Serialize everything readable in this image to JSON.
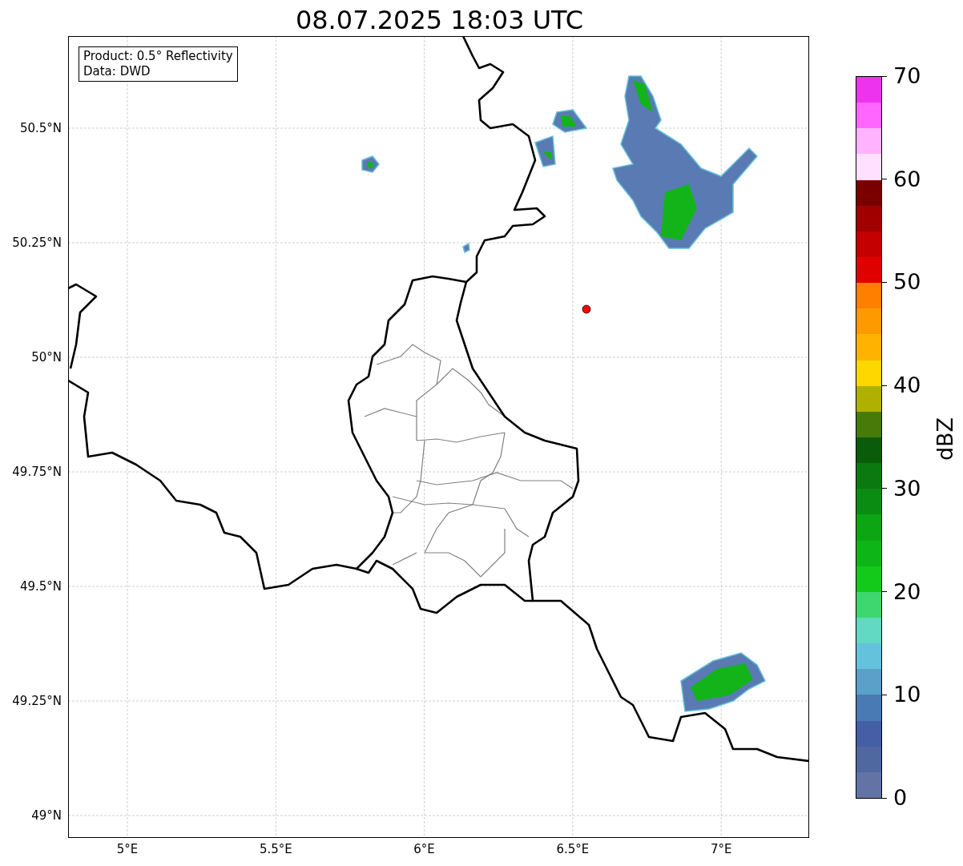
{
  "title": "08.07.2025 18:03 UTC",
  "legend": [
    "Product: 0.5° Reflectivity",
    "Data: DWD"
  ],
  "lat_ticks": [
    "50.5°N",
    "50.25°N",
    "50°N",
    "49.75°N",
    "49.5°N",
    "49.25°N",
    "49°N"
  ],
  "lon_ticks": [
    "5°E",
    "5.5°E",
    "6°E",
    "6.5°E",
    "7°E"
  ],
  "colorbar": {
    "label": "dBZ",
    "ticks": [
      "70",
      "60",
      "50",
      "40",
      "30",
      "20",
      "10",
      "0"
    ],
    "segments": [
      {
        "color": "#ee33ee"
      },
      {
        "color": "#ff66ff"
      },
      {
        "color": "#ffb3ff"
      },
      {
        "color": "#ffe0ff"
      },
      {
        "color": "#7a0000"
      },
      {
        "color": "#a00000"
      },
      {
        "color": "#c40000"
      },
      {
        "color": "#e00000"
      },
      {
        "color": "#ff7f00"
      },
      {
        "color": "#ff9900"
      },
      {
        "color": "#ffb300"
      },
      {
        "color": "#ffd700"
      },
      {
        "color": "#b0b000"
      },
      {
        "color": "#487a0a"
      },
      {
        "color": "#0a5c0a"
      },
      {
        "color": "#0a7a10"
      },
      {
        "color": "#0a8c12"
      },
      {
        "color": "#0ca514"
      },
      {
        "color": "#0eb516"
      },
      {
        "color": "#13c91a"
      },
      {
        "color": "#3ed66e"
      },
      {
        "color": "#62d9c2"
      },
      {
        "color": "#64c3dc"
      },
      {
        "color": "#5aa0c8"
      },
      {
        "color": "#4a7ab4"
      },
      {
        "color": "#445fa6"
      },
      {
        "color": "#5068a0"
      },
      {
        "color": "#6373a6"
      }
    ]
  }
}
